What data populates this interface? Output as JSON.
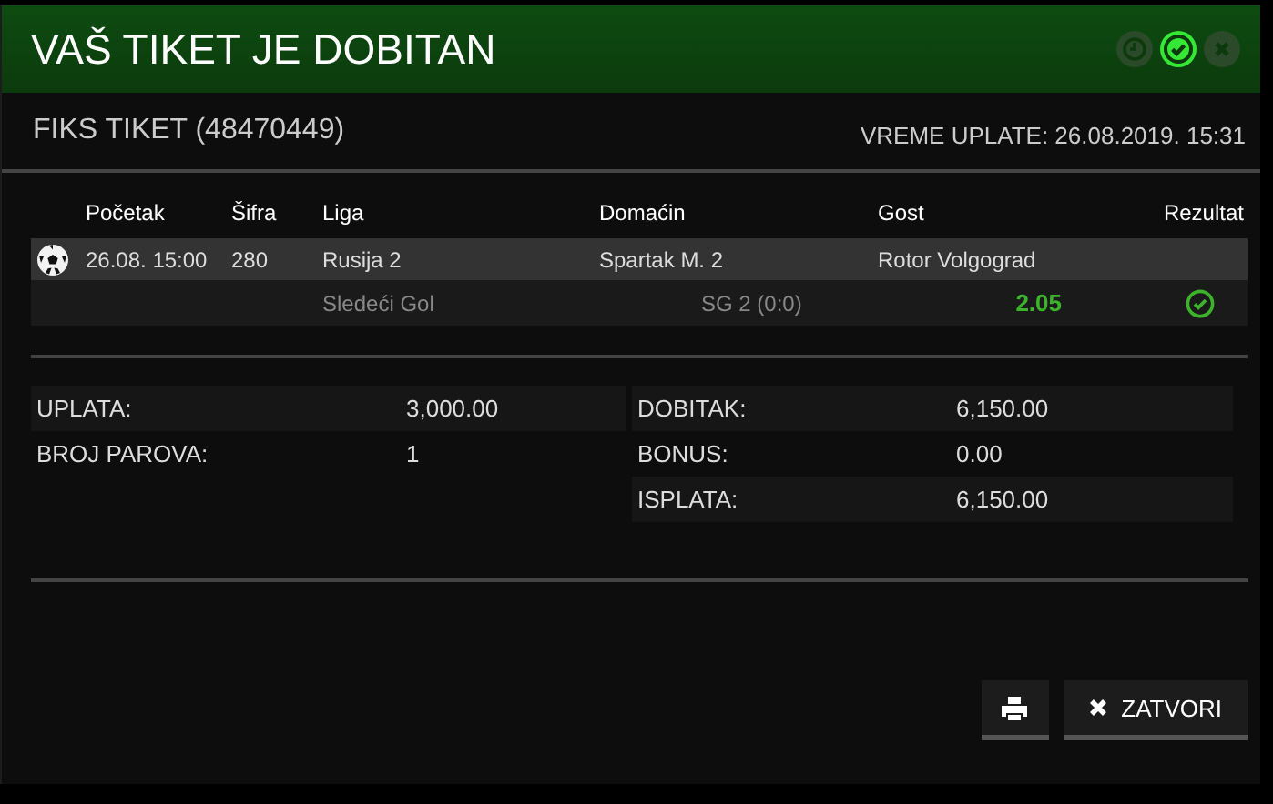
{
  "window": {
    "title": "VAŠ TIKET JE DOBITAN"
  },
  "status_icons": [
    {
      "kind": "pending",
      "selected": false
    },
    {
      "kind": "won",
      "selected": true
    },
    {
      "kind": "lost",
      "selected": false
    }
  ],
  "ticket": {
    "title": "FIKS TIKET (48470449)",
    "time": "VREME UPLATE: 26.08.2019. 15:31"
  },
  "table": {
    "columns": [
      "Početak",
      "Šifra",
      "Liga",
      "Domaćin",
      "Gost",
      "Rezultat"
    ],
    "rows": [
      {
        "kind": "football",
        "start": "26.08. 15:00",
        "code": "280",
        "league": "Rusija 2",
        "home": "Spartak M. 2",
        "away": "Rotor Volgograd",
        "market": "Sledeći Gol",
        "pick": "SG 2 (0:0)",
        "odds": "2.05",
        "won": true
      }
    ]
  },
  "summary_left": [
    {
      "label": "UPLATA:",
      "value": "3,000.00"
    },
    {
      "label": "BROJ PAROVA:",
      "value": "1"
    }
  ],
  "summary_right": [
    {
      "label": "DOBITAK:",
      "value": "6,150.00"
    },
    {
      "label": "BONUS:",
      "value": "0.00"
    },
    {
      "label": "ISPLATA:",
      "value": "6,150.00"
    }
  ],
  "buttons": {
    "close": "ZATVORI"
  }
}
